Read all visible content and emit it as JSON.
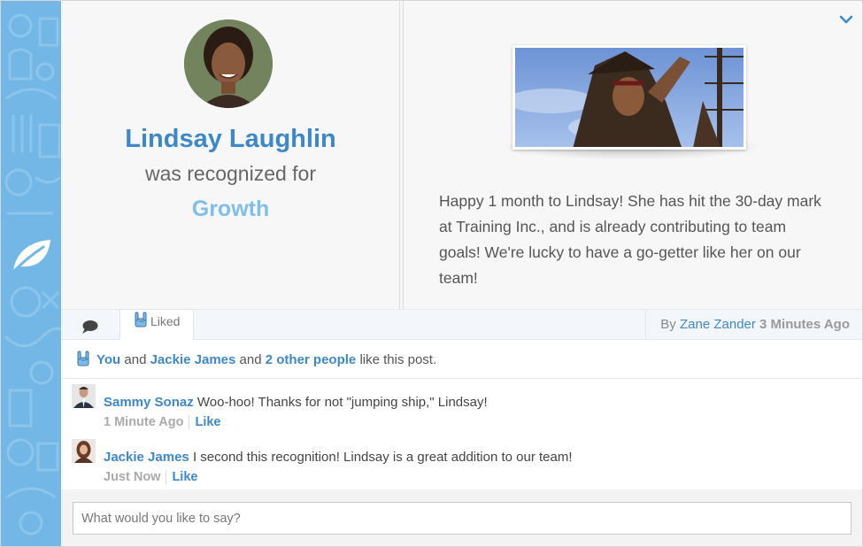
{
  "recipient": {
    "name": "Lindsay Laughlin",
    "recognized_text": "was recognized for",
    "value": "Growth"
  },
  "post": {
    "message": "Happy 1 month to Lindsay! She has hit the 30-day mark at Training Inc., and is already contributing to team goals! We're lucky to have a go-getter like her on our team!",
    "media": "pirate-gif"
  },
  "tabs": {
    "comment_icon": "speech-bubble-icon",
    "liked_label": "Liked"
  },
  "byline": {
    "prefix": "By",
    "author": "Zane Zander",
    "time": "3 Minutes Ago"
  },
  "likes": {
    "you": "You",
    "and1": "and",
    "person": "Jackie James",
    "and2": "and",
    "others": "2 other people",
    "suffix": "like this post."
  },
  "comments": [
    {
      "name": "Sammy Sonaz",
      "text": "Woo-hoo! Thanks for not \"jumping ship,\" Lindsay!",
      "time": "1 Minute Ago",
      "like_label": "Like"
    },
    {
      "name": "Jackie James",
      "text": "I second this recognition! Lindsay is a great addition to our team!",
      "time": "Just Now",
      "like_label": "Like"
    }
  ],
  "reply": {
    "placeholder": "What would you like to say?"
  },
  "colors": {
    "accent": "#3d88c9",
    "value": "#80bfe8",
    "strip": "#73b7e6"
  }
}
